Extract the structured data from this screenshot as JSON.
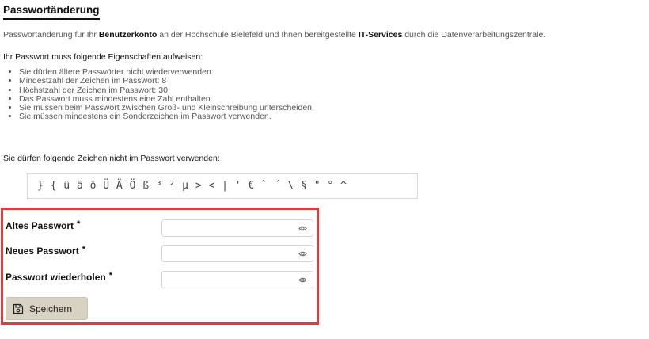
{
  "page": {
    "title": "Passwortänderung",
    "intro": {
      "part1": "Passwortänderung für Ihr ",
      "bold1": "Benutzerkonto",
      "part2": " an der Hochschule Bielefeld und Ihnen bereitgestellte ",
      "bold2": "IT-Services",
      "part3": " durch die Datenverarbeitungszentrale."
    },
    "requirements_heading": "Ihr Passwort muss folgende Eigenschaften aufweisen:",
    "requirements": [
      "Sie dürfen ältere Passwörter nicht wiederverwenden.",
      "Mindestzahl der Zeichen im Passwort: 8",
      "Höchstzahl der Zeichen im Passwort: 30",
      "Das Passwort muss mindestens eine Zahl enthalten.",
      "Sie müssen beim Passwort zwischen Groß- und Kleinschreibung unterscheiden.",
      "Sie müssen mindestens ein Sonderzeichen im Passwort verwenden."
    ],
    "forbidden_heading": "Sie dürfen folgende Zeichen nicht im Passwort verwenden:",
    "forbidden_chars": "} { ü ä ö Ü Ä Ö ß ³ ² µ > < | ' € ` ´ \\ § \" ° ^"
  },
  "form": {
    "highlight_color": "#e0393e",
    "fields": [
      {
        "label": "Altes Passwort",
        "required": "*",
        "value": "",
        "placeholder": ""
      },
      {
        "label": "Neues Passwort",
        "required": "*",
        "value": "",
        "placeholder": ""
      },
      {
        "label": "Passwort wiederholen",
        "required": "*",
        "value": "",
        "placeholder": ""
      }
    ],
    "save_label": "Speichern",
    "save_icon": "floppy-disk-icon",
    "visibility_icon": "eye-icon"
  }
}
